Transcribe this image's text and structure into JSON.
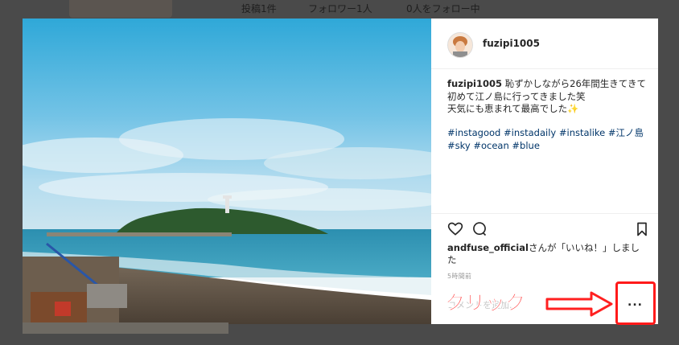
{
  "background_stats": {
    "posts": "投稿1件",
    "followers": "フォロワー1人",
    "following": "0人をフォロー中"
  },
  "post": {
    "username": "fuzipi1005",
    "caption_user": "fuzipi1005",
    "caption_line1": "恥ずかしながら26年間生きてきて",
    "caption_line2": "初めて江ノ島に行ってきました笑",
    "caption_line3": "天気にも恵まれて最高でした✨",
    "hashtags_line1": "#instagood #instadaily #instalike #江ノ島",
    "hashtags_line2": "#sky #ocean #blue",
    "like_user": "andfuse_official",
    "like_text": "さんが「いいね！」しました",
    "timestamp": "5時間前",
    "comment_placeholder": "コメントを追加..."
  },
  "more_button": {
    "label": "..."
  },
  "annotation": {
    "text": "クリック"
  },
  "colors": {
    "overlay": "#4a4a4a",
    "annotation_red": "#ff2020",
    "hashtag_blue": "#003569"
  },
  "icons": [
    "heart-icon",
    "comment-icon",
    "bookmark-icon",
    "more-options-icon",
    "arrow-icon"
  ]
}
